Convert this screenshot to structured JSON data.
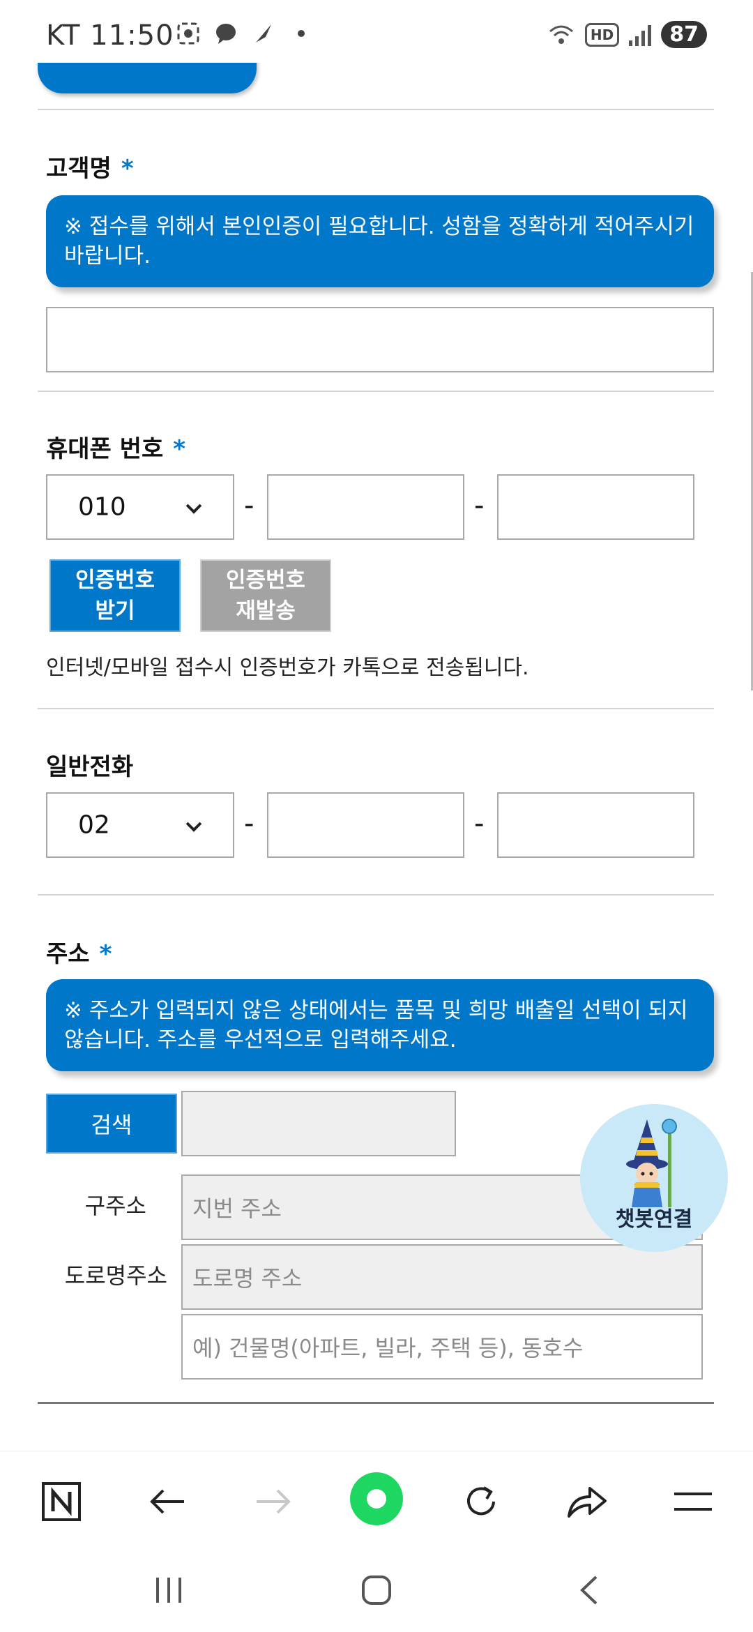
{
  "status": {
    "carrier": "KT",
    "time": "11:50",
    "hd": "HD",
    "battery": "87"
  },
  "form": {
    "customer": {
      "label": "고객명",
      "required_mark": "*",
      "notice": "※ 접수를 위해서 본인인증이 필요합니다. 성함을 정확하게 적어주시기 바랍니다."
    },
    "mobile": {
      "label": "휴대폰 번호",
      "required_mark": "*",
      "prefix": "010",
      "dash": "-",
      "get_code_button": "인증번호 받기",
      "resend_button": "인증번호 재발송",
      "helper": "인터넷/모바일 접수시 인증번호가 카톡으로 전송됩니다."
    },
    "phone": {
      "label": "일반전화",
      "prefix": "02",
      "dash": "-"
    },
    "address": {
      "label": "주소",
      "required_mark": "*",
      "notice": "※ 주소가 입력되지 않은 상태에서는 품목 및 희망 배출일 선택이 되지 않습니다. 주소를 우선적으로 입력해주세요.",
      "search_button": "검색",
      "old_label": "구주소",
      "old_placeholder": "지번 주소",
      "road_label": "도로명주소",
      "road_placeholder": "도로명 주소",
      "detail_placeholder": "예) 건물명(아파트, 빌라, 주택 등), 동호수"
    }
  },
  "chatbot": {
    "label": "챗봇연결"
  },
  "browser": {
    "icons": [
      "naver-n-icon",
      "back-arrow-icon",
      "forward-arrow-icon",
      "home-circle-icon",
      "refresh-icon",
      "share-icon",
      "menu-icon"
    ]
  },
  "colors": {
    "primary": "#0077c8",
    "gray_button": "#a3a3a3",
    "green": "#1ed760"
  }
}
